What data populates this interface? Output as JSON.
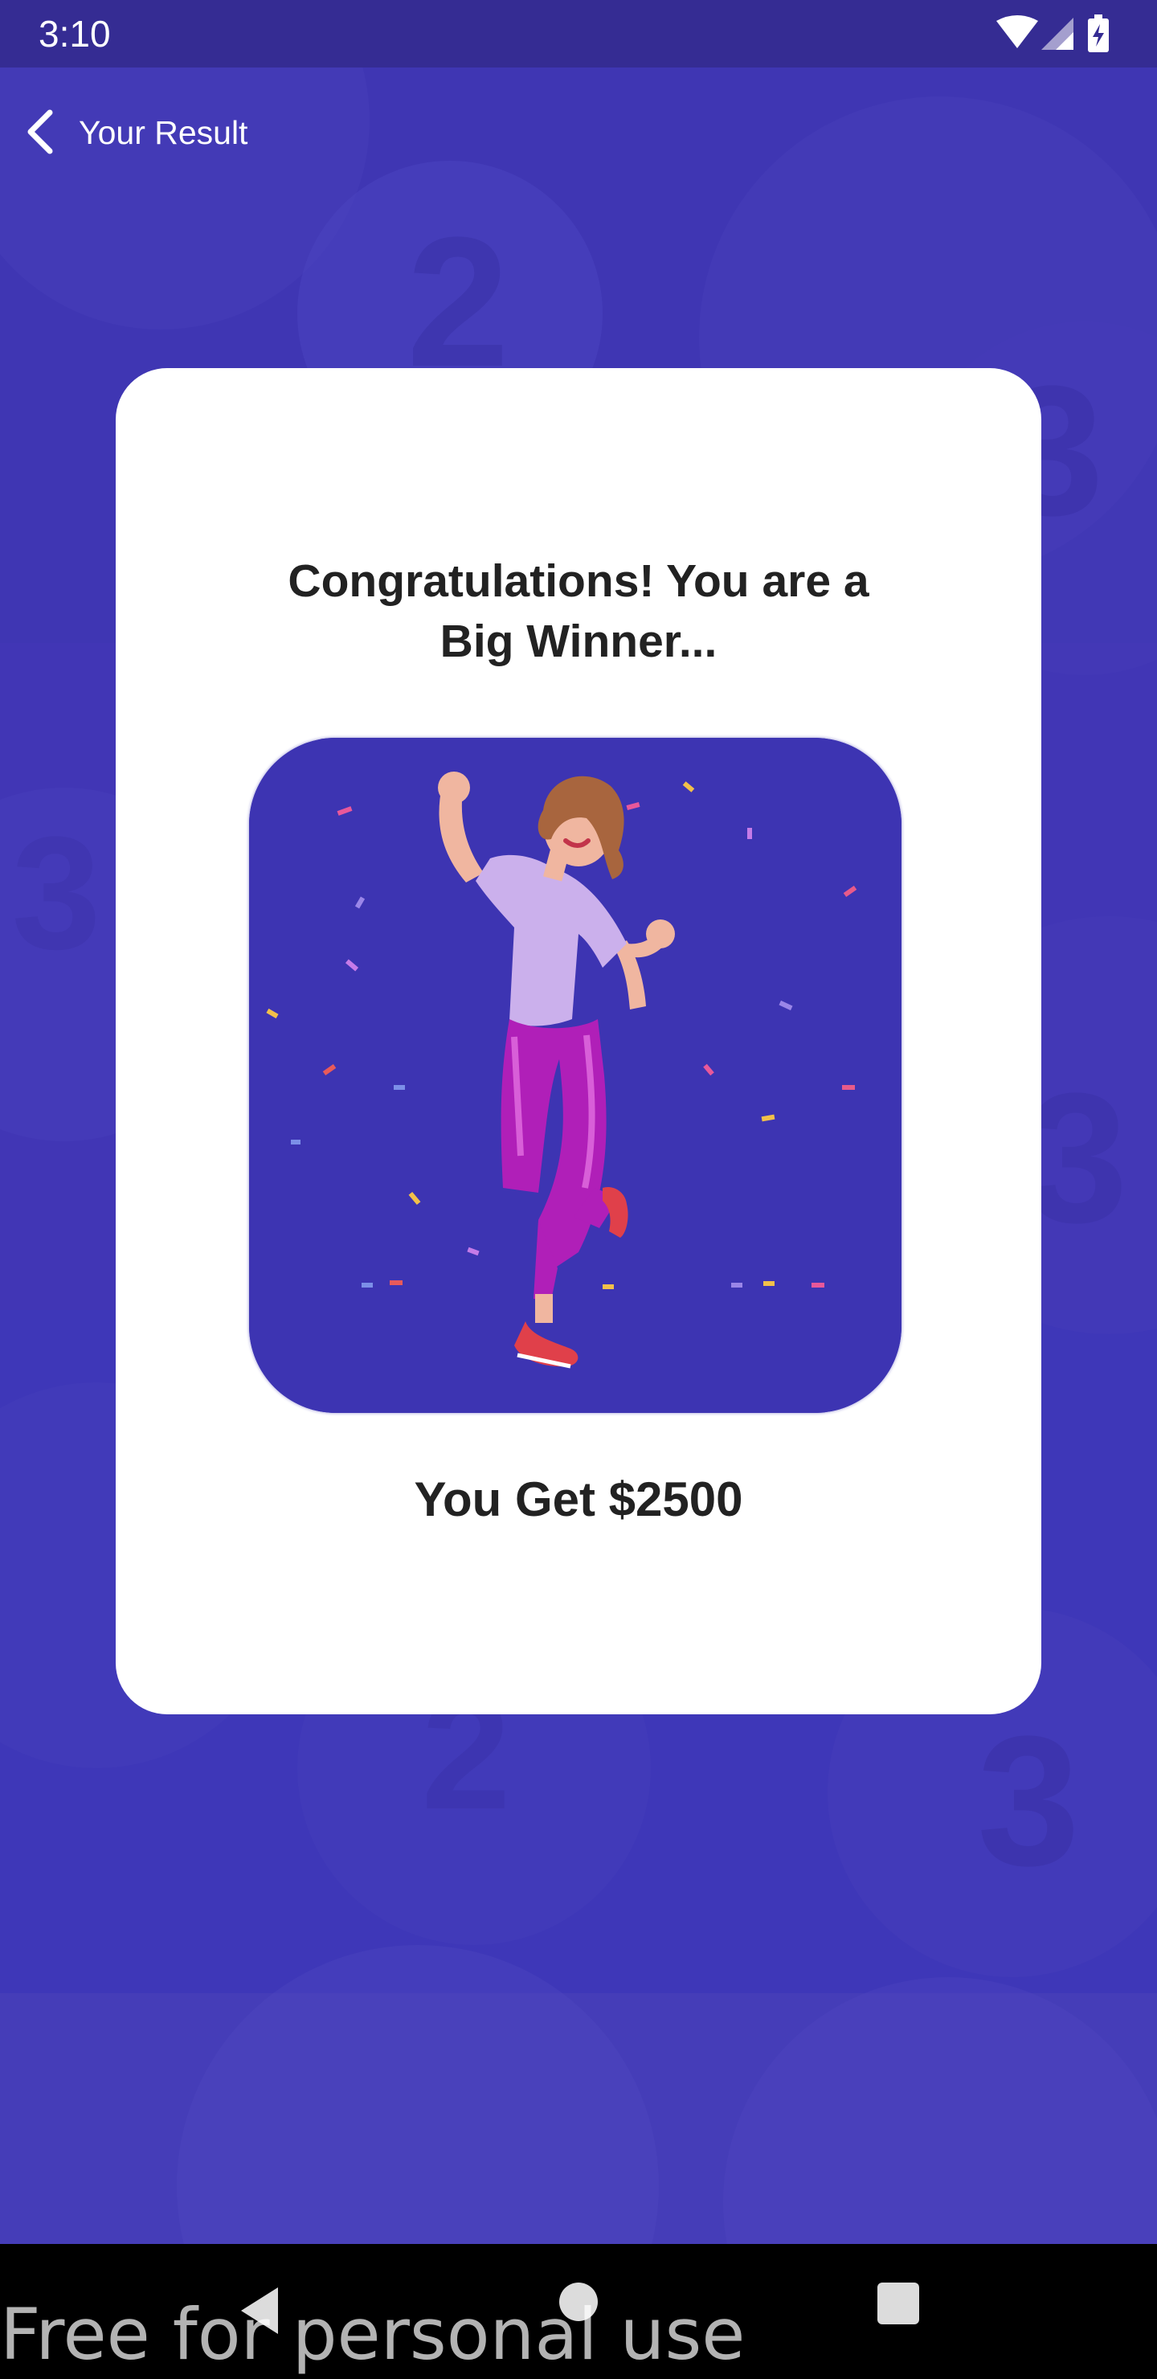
{
  "status_bar": {
    "time": "3:10",
    "icons": [
      "wifi-icon",
      "cellular-signal-icon",
      "battery-charging-icon"
    ]
  },
  "app_bar": {
    "back_icon": "chevron-left-icon",
    "title": "Your Result"
  },
  "result_card": {
    "headline": "Congratulations! You are a Big Winner...",
    "image": "celebrating-woman-illustration",
    "prize": "You Get $2500"
  },
  "background": {
    "decorative_numbers": [
      "2",
      "3",
      "3",
      "3",
      "2",
      "3"
    ]
  },
  "nav_bar": {
    "buttons": [
      "back-triangle-icon",
      "home-circle-icon",
      "recents-square-icon"
    ]
  },
  "watermark": "Free for personal use",
  "colors": {
    "background": "#3f36b3",
    "status_bar": "#352c93",
    "card": "#ffffff",
    "image_background": "#3d34b2",
    "text_dark": "#222222",
    "nav_bar": "#000000"
  }
}
